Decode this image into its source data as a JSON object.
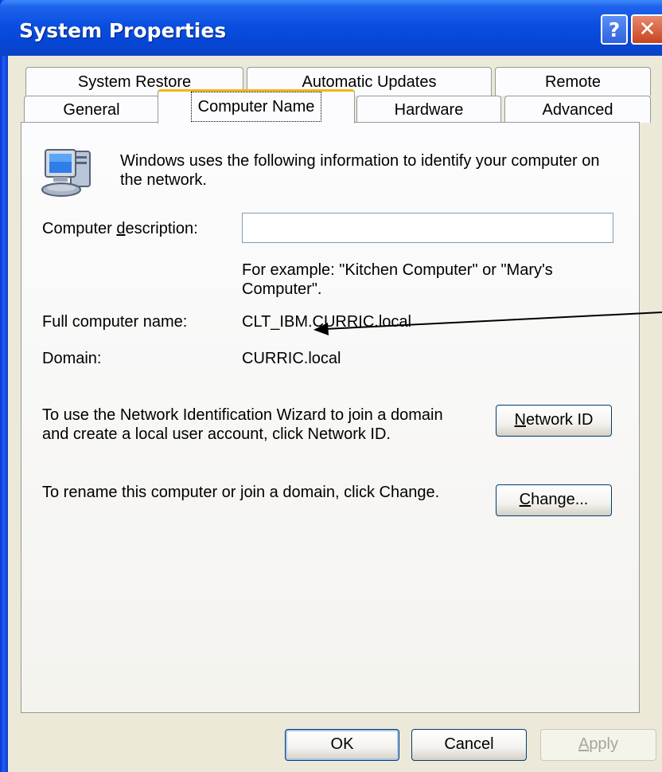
{
  "window": {
    "title": "System Properties"
  },
  "titlebar": {
    "help_glyph": "?",
    "close_glyph": "✕"
  },
  "tabs": {
    "row1": [
      "System Restore",
      "Automatic Updates",
      "Remote"
    ],
    "row2": [
      "General",
      "Computer Name",
      "Hardware",
      "Advanced"
    ],
    "selected": "Computer Name"
  },
  "panel": {
    "intro": "Windows uses the following information to identify your computer on the network.",
    "description_label_pre": "Computer ",
    "description_label_key": "d",
    "description_label_post": "escription:",
    "description_value": "",
    "example": "For example: \"Kitchen Computer\" or \"Mary's Computer\".",
    "full_name_label": "Full computer name:",
    "full_name_value": "CLT_IBM.CURRIC.local",
    "domain_label": "Domain:",
    "domain_value": "CURRIC.local",
    "network_id_text": "To use the Network Identification Wizard to join a domain and create a local user account, click Network ID.",
    "network_id_button_key": "N",
    "network_id_button_rest": "etwork ID",
    "rename_text": "To rename this computer or join a domain, click Change.",
    "change_button_key": "C",
    "change_button_rest": "hange..."
  },
  "footer": {
    "ok_label": "OK",
    "cancel_label": "Cancel",
    "apply_key": "A",
    "apply_rest": "pply"
  },
  "icons": [
    "computer-network-icon",
    "help-icon",
    "close-icon"
  ]
}
